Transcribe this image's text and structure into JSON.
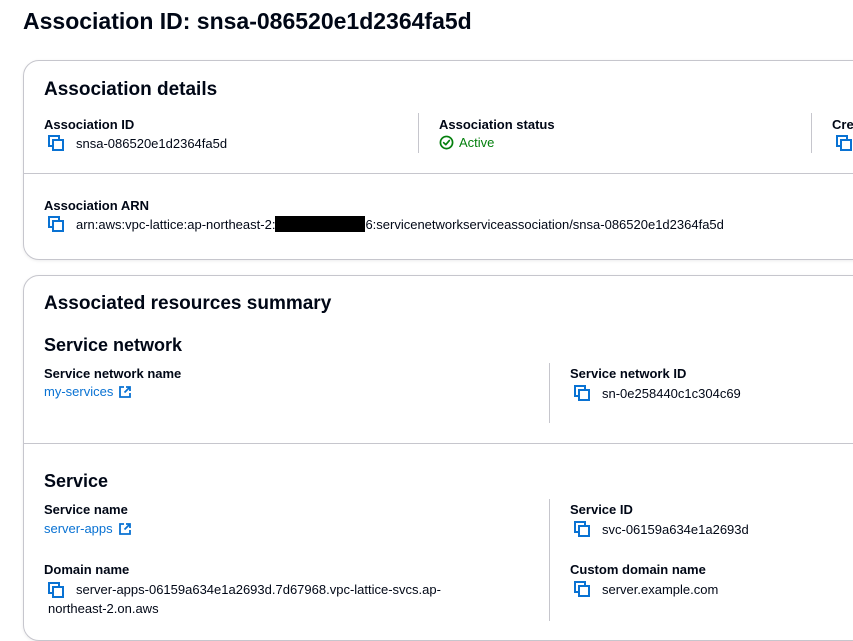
{
  "page": {
    "title": "Association ID: snsa-086520e1d2364fa5d"
  },
  "association_details": {
    "heading": "Association details",
    "id_label": "Association ID",
    "id_value": "snsa-086520e1d2364fa5d",
    "status_label": "Association status",
    "status_value": "Active",
    "created_label_partial": "Cre",
    "arn_label": "Association ARN",
    "arn_prefix": "arn:aws:vpc-lattice:ap-northeast-2:",
    "arn_suffix": "6:servicenetworkserviceassociation/snsa-086520e1d2364fa5d"
  },
  "summary": {
    "heading": "Associated resources summary",
    "service_network": {
      "heading": "Service network",
      "name_label": "Service network name",
      "name_value": "my-services",
      "id_label": "Service network ID",
      "id_value": "sn-0e258440c1c304c69"
    },
    "service": {
      "heading": "Service",
      "name_label": "Service name",
      "name_value": "server-apps",
      "id_label": "Service ID",
      "id_value": "svc-06159a634e1a2693d",
      "domain_label": "Domain name",
      "domain_value": "server-apps-06159a634e1a2693d.7d67968.vpc-lattice-svcs.ap-northeast-2.on.aws",
      "custom_domain_label": "Custom domain name",
      "custom_domain_value": "server.example.com"
    }
  },
  "colors": {
    "link": "#0972d3",
    "success": "#037f0c",
    "border": "#c6c6cd",
    "text": "#000716"
  }
}
